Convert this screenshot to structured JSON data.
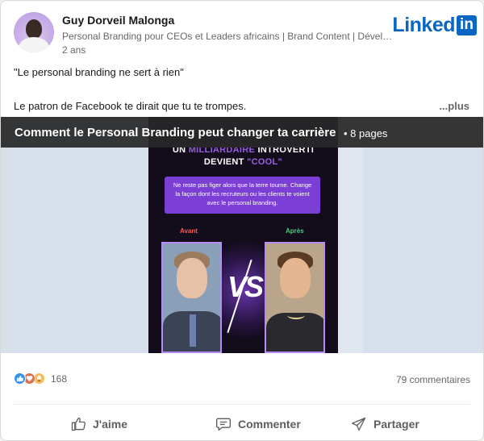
{
  "post": {
    "author": "Guy Dorveil Malonga",
    "headline": "Personal Branding pour CEOs et Leaders africains | Brand Content | Développement",
    "age": "2 ans",
    "brand_text": "Linked",
    "brand_in": "in",
    "text_line1": "\"Le personal branding ne sert à rien\"",
    "text_line2": "Le patron de Facebook te dirait que tu te trompes.",
    "see_more": "...plus"
  },
  "document": {
    "title": "Comment le Personal Branding peut changer ta carrière",
    "pages": "• 8 pages",
    "slide": {
      "line1_a": "UN ",
      "line1_b": "MILLIARDAIRE",
      "line1_c": " INTROVERTI",
      "line2_a": "DEVIENT ",
      "line2_b": "\"COOL\"",
      "message": "Ne reste pas figer alors que la terre tourne. Change la façon dont les recruteurs ou les clients te voient avec le personal branding.",
      "before": "Avant",
      "after": "Après",
      "vs": "VS"
    }
  },
  "social": {
    "reactions_count": "168",
    "comments": "79 commentaires"
  },
  "actions": {
    "like": "J'aime",
    "comment": "Commenter",
    "share": "Partager"
  },
  "colors": {
    "brand": "#0a66c2",
    "slide_bg": "#120c1b",
    "slide_accent": "#7b3fd6",
    "before": "#ff5a4f",
    "after": "#3fd17a"
  }
}
